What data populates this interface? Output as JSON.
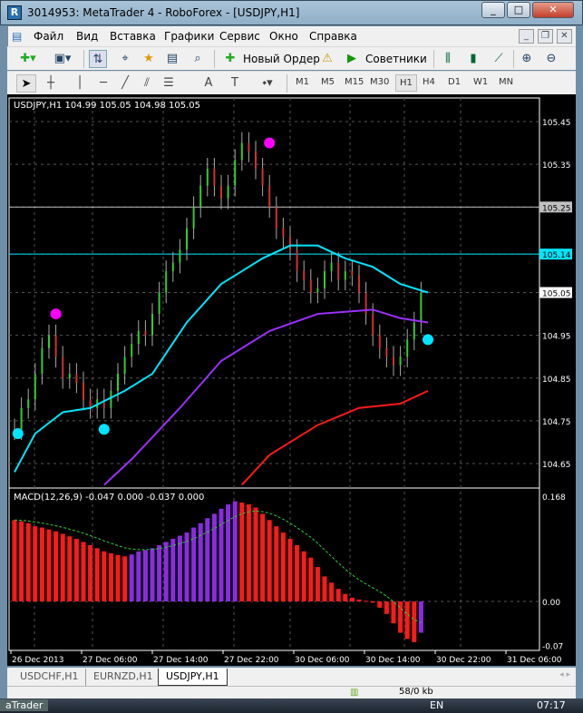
{
  "window": {
    "title": "3014953: MetaTrader 4 - RoboForex - [USDJPY,H1]",
    "min": "_",
    "max": "□",
    "close": "✕"
  },
  "menu": [
    "Файл",
    "Вид",
    "Вставка",
    "Графики",
    "Сервис",
    "Окно",
    "Справка"
  ],
  "toolbar": {
    "new_order": "Новый Ордер",
    "advisors": "Советники"
  },
  "timeframes": [
    "M1",
    "M5",
    "M15",
    "M30",
    "H1",
    "H4",
    "D1",
    "W1",
    "MN"
  ],
  "active_timeframe": "H1",
  "chart": {
    "header": "USDJPY,H1  104.99 105.05 104.98 105.05",
    "price_labels": [
      "105.45",
      "105.35",
      "105.25",
      "105.14",
      "105.05",
      "104.95",
      "104.85",
      "104.75",
      "104.65"
    ],
    "hlines": [
      {
        "price": 105.25,
        "label": "105.25",
        "color": "#c0c0c0"
      },
      {
        "price": 105.14,
        "label": "105.14",
        "color": "#00e5ff"
      }
    ],
    "current_price": "105.05",
    "closes": [
      104.73,
      104.78,
      104.8,
      104.86,
      104.92,
      104.95,
      104.9,
      104.85,
      104.86,
      104.84,
      104.8,
      104.78,
      104.8,
      104.78,
      104.82,
      104.86,
      104.9,
      104.93,
      104.96,
      104.95,
      105.0,
      105.05,
      105.1,
      105.12,
      105.15,
      105.2,
      105.25,
      105.3,
      105.34,
      105.3,
      105.27,
      105.3,
      105.36,
      105.4,
      105.38,
      105.34,
      105.3,
      105.25,
      105.2,
      105.18,
      105.15,
      105.1,
      105.08,
      105.05,
      105.06,
      105.1,
      105.12,
      105.08,
      105.1,
      105.09,
      105.05,
      105.0,
      104.95,
      104.92,
      104.9,
      104.88,
      104.9,
      104.94,
      104.98,
      105.05
    ],
    "ma_cyan": [
      [
        0,
        104.63
      ],
      [
        3,
        104.72
      ],
      [
        7,
        104.77
      ],
      [
        11,
        104.78
      ],
      [
        16,
        104.82
      ],
      [
        20,
        104.86
      ],
      [
        25,
        104.98
      ],
      [
        30,
        105.07
      ],
      [
        36,
        105.13
      ],
      [
        40,
        105.16
      ],
      [
        44,
        105.16
      ],
      [
        48,
        105.13
      ],
      [
        52,
        105.11
      ],
      [
        56,
        105.07
      ],
      [
        60,
        105.05
      ]
    ],
    "ma_purple": [
      [
        13,
        104.6
      ],
      [
        17,
        104.66
      ],
      [
        24,
        104.78
      ],
      [
        30,
        104.89
      ],
      [
        37,
        104.96
      ],
      [
        44,
        105.0
      ],
      [
        52,
        105.01
      ],
      [
        56,
        104.99
      ],
      [
        60,
        104.98
      ]
    ],
    "ma_red": [
      [
        33,
        104.6
      ],
      [
        37,
        104.67
      ],
      [
        44,
        104.74
      ],
      [
        50,
        104.78
      ],
      [
        56,
        104.79
      ],
      [
        60,
        104.82
      ]
    ],
    "dots_cyan": [
      [
        0.5,
        104.72
      ],
      [
        13,
        104.73
      ],
      [
        60,
        104.94
      ]
    ],
    "dots_magenta": [
      [
        6,
        105.0
      ],
      [
        37,
        105.4
      ]
    ]
  },
  "chart_data": {
    "type": "bar",
    "title": "MACD(12,26,9) -0.047 0.000 -0.037 0.000",
    "ylim": [
      -0.07,
      0.168
    ],
    "tick_labels": [
      "0.168",
      "0.00",
      "-0.07"
    ],
    "values": [
      0.13,
      0.128,
      0.125,
      0.12,
      0.118,
      0.115,
      0.112,
      0.108,
      0.104,
      0.1,
      0.095,
      0.09,
      0.085,
      0.08,
      0.077,
      0.074,
      0.072,
      0.075,
      0.08,
      0.082,
      0.085,
      0.09,
      0.095,
      0.1,
      0.105,
      0.11,
      0.118,
      0.125,
      0.133,
      0.14,
      0.148,
      0.155,
      0.16,
      0.158,
      0.155,
      0.15,
      0.14,
      0.13,
      0.12,
      0.11,
      0.1,
      0.09,
      0.08,
      0.07,
      0.055,
      0.04,
      0.03,
      0.02,
      0.012,
      0.006,
      0.003,
      0.001,
      -0.002,
      -0.01,
      -0.02,
      -0.035,
      -0.05,
      -0.06,
      -0.065,
      -0.05
    ]
  },
  "time_labels": [
    "26 Dec 2013",
    "27 Dec 06:00",
    "27 Dec 14:00",
    "27 Dec 22:00",
    "30 Dec 06:00",
    "30 Dec 14:00",
    "30 Dec 22:00",
    "31 Dec 06:00"
  ],
  "tabs": [
    "USDCHF,H1",
    "EURNZD,H1",
    "USDJPY,H1"
  ],
  "status": {
    "traffic": "58/0 kb"
  },
  "taskbar": {
    "app": "aTrader",
    "lang": "EN",
    "clock": "07:17"
  }
}
